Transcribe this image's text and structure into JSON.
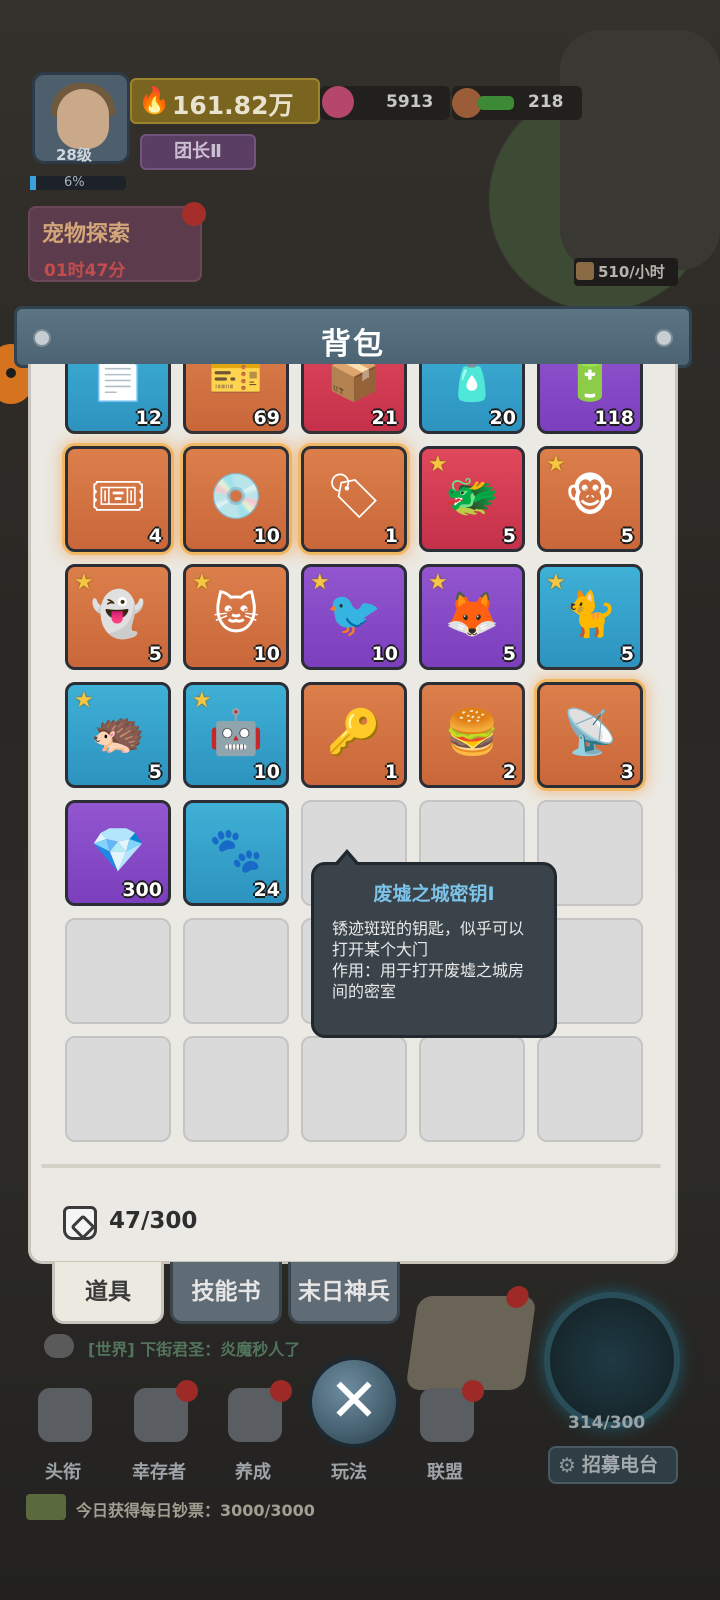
{
  "hud": {
    "level": "28级",
    "xp_percent": "6%",
    "power": "161.82万",
    "rank": "团长Ⅱ",
    "gems": "5913",
    "food": "218",
    "explore_title": "宠物探索",
    "explore_timer": "01时47分",
    "production_rate": "510/小时"
  },
  "backpack": {
    "title": "背包",
    "capacity": "47/300",
    "items": [
      {
        "count": "12",
        "rarity": "blue",
        "icon": "document-icon",
        "star": false,
        "glow": false
      },
      {
        "count": "69",
        "rarity": "orange",
        "icon": "ticket-icon",
        "star": false,
        "glow": false
      },
      {
        "count": "21",
        "rarity": "red",
        "icon": "crate-icon",
        "star": false,
        "glow": false
      },
      {
        "count": "20",
        "rarity": "blue",
        "icon": "bottle-icon",
        "star": false,
        "glow": false
      },
      {
        "count": "118",
        "rarity": "purple",
        "icon": "battery-icon",
        "star": false,
        "glow": false
      },
      {
        "count": "4",
        "rarity": "orange",
        "icon": "pet-ticket-icon",
        "star": false,
        "glow": true
      },
      {
        "count": "10",
        "rarity": "orange",
        "icon": "disc-icon",
        "star": false,
        "glow": true
      },
      {
        "count": "1",
        "rarity": "orange",
        "icon": "dog-tag-icon",
        "star": false,
        "glow": true
      },
      {
        "count": "5",
        "rarity": "red",
        "icon": "fire-dragon-pet-icon",
        "star": true,
        "glow": false
      },
      {
        "count": "5",
        "rarity": "orange",
        "icon": "monkey-pet-icon",
        "star": true,
        "glow": false
      },
      {
        "count": "5",
        "rarity": "orange",
        "icon": "ghost-pet-icon",
        "star": true,
        "glow": false
      },
      {
        "count": "10",
        "rarity": "orange",
        "icon": "grey-cat-pet-icon",
        "star": true,
        "glow": false
      },
      {
        "count": "10",
        "rarity": "purple",
        "icon": "bird-pet-icon",
        "star": true,
        "glow": false
      },
      {
        "count": "5",
        "rarity": "purple",
        "icon": "cream-cat-pet-icon",
        "star": true,
        "glow": false
      },
      {
        "count": "5",
        "rarity": "blue",
        "icon": "white-cat-pet-icon",
        "star": true,
        "glow": false
      },
      {
        "count": "5",
        "rarity": "blue",
        "icon": "hedgehog-pet-icon",
        "star": true,
        "glow": false
      },
      {
        "count": "10",
        "rarity": "blue",
        "icon": "sprout-robot-pet-icon",
        "star": true,
        "glow": false
      },
      {
        "count": "1",
        "rarity": "orange",
        "icon": "key-icon",
        "star": false,
        "glow": false
      },
      {
        "count": "2",
        "rarity": "orange",
        "icon": "burger-icon",
        "star": false,
        "glow": false
      },
      {
        "count": "3",
        "rarity": "orange",
        "icon": "radar-device-icon",
        "star": false,
        "glow": true
      },
      {
        "count": "300",
        "rarity": "purple",
        "icon": "ore-icon",
        "star": false,
        "glow": false
      },
      {
        "count": "24",
        "rarity": "blue",
        "icon": "pet-food-icon",
        "star": false,
        "glow": false
      }
    ],
    "empty_slots": 13,
    "tooltip": {
      "name": "废墟之城密钥Ⅰ",
      "description": "锈迹斑斑的钥匙，似乎可以打开某个大门",
      "usage": "作用：用于打开废墟之城房间的密室"
    }
  },
  "tabs": [
    {
      "label": "道具",
      "active": true
    },
    {
      "label": "技能书",
      "active": false
    },
    {
      "label": "末日神兵",
      "active": false
    }
  ],
  "chat": {
    "text": "[世界] 下街君圣：炎魔秒人了"
  },
  "nav": [
    {
      "label": "头衔",
      "icon": "shield-star-icon",
      "badge": false
    },
    {
      "label": "幸存者",
      "icon": "hat-icon",
      "badge": true
    },
    {
      "label": "养成",
      "icon": "grid-icon",
      "badge": true
    },
    {
      "label": "玩法",
      "icon": "swords-icon",
      "badge": true
    },
    {
      "label": "联盟",
      "icon": "alliance-icon",
      "badge": true
    }
  ],
  "close_label": "✕",
  "recruit": {
    "count": "314/300",
    "label": "招募电台"
  },
  "daily": {
    "text": "今日获得每日钞票：3000/3000"
  },
  "colors": {
    "rarity_orange": "#dc7f4b",
    "rarity_blue": "#3fb0d6",
    "rarity_purple": "#9356d0",
    "rarity_red": "#e0485c",
    "tooltip_title": "#7cc3ea"
  }
}
